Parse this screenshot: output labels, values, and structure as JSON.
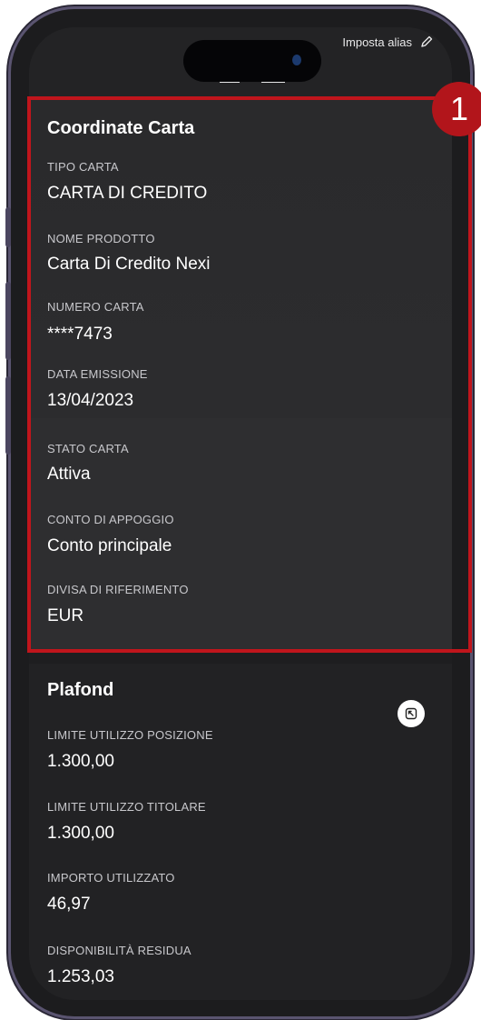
{
  "header": {
    "alias_label": "Imposta alias",
    "alias_icon": "pencil-icon"
  },
  "card_details": {
    "title": "Coordinate Carta",
    "fields": [
      {
        "label": "TIPO CARTA",
        "value": "CARTA DI CREDITO"
      },
      {
        "label": "NOME PRODOTTO",
        "value": "Carta Di Credito Nexi"
      },
      {
        "label": "NUMERO CARTA",
        "value": "****7473"
      },
      {
        "label": "DATA EMISSIONE",
        "value": "13/04/2023"
      },
      {
        "label": "STATO CARTA",
        "value": "Attiva"
      },
      {
        "label": "CONTO DI APPOGGIO",
        "value": "Conto principale"
      },
      {
        "label": "DIVISA DI RIFERIMENTO",
        "value": "EUR"
      }
    ]
  },
  "annotation": {
    "badge_number": "1",
    "highlight_color": "#c0151c"
  },
  "plafond": {
    "title": "Plafond",
    "expand_icon": "expand-icon",
    "fields": [
      {
        "label": "LIMITE UTILIZZO POSIZIONE",
        "value": "1.300,00"
      },
      {
        "label": "LIMITE UTILIZZO TITOLARE",
        "value": "1.300,00"
      },
      {
        "label": "IMPORTO UTILIZZATO",
        "value": "46,97"
      },
      {
        "label": "DISPONIBILITÀ RESIDUA",
        "value": "1.253,03"
      }
    ]
  }
}
